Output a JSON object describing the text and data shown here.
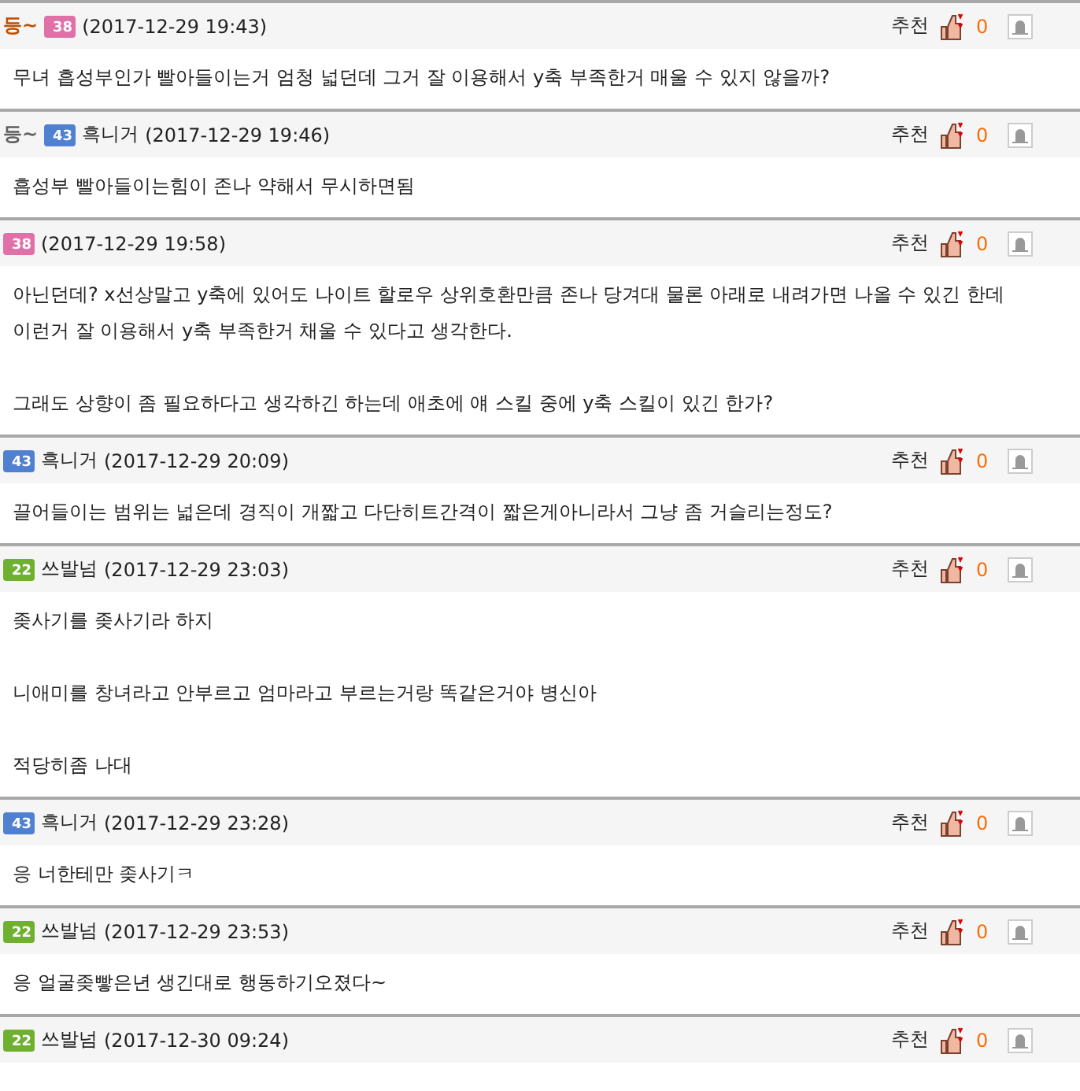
{
  "comments": [
    {
      "rank": {
        "text": "등~",
        "color": "#c05000"
      },
      "level": "38",
      "color": "#e070a8",
      "time": "(2017-12-29 19:43)",
      "recommend_label": "추천",
      "recommend_count": "0",
      "body": "무녀 흡성부인가 빨아들이는거 엄청 넓던데 그거 잘 이용해서 y축 부족한거 매울 수 있지 않을까?"
    },
    {
      "rank": {
        "text": "등~",
        "color": "#606060"
      },
      "level": "43",
      "color": "#5080d0",
      "author": "흑니거",
      "time": "(2017-12-29 19:46)",
      "recommend_label": "추천",
      "recommend_count": "0",
      "body": "흡성부 빨아들이는힘이 존나 약해서 무시하면됨"
    },
    {
      "level": "38",
      "color": "#e070a8",
      "time": "(2017-12-29 19:58)",
      "recommend_label": "추천",
      "recommend_count": "0",
      "body": "아닌던데? x선상말고 y축에 있어도 나이트 할로우 상위호환만큼 존나 당겨대 물론 아래로 내려가면 나올 수 있긴 한데\n이런거 잘 이용해서 y축 부족한거 채울 수 있다고 생각한다.\n\n그래도 상향이 좀 필요하다고 생각하긴 하는데 애초에 얘 스킬 중에 y축 스킬이 있긴 한가?"
    },
    {
      "level": "43",
      "color": "#5080d0",
      "author": "흑니거",
      "time": "(2017-12-29 20:09)",
      "recommend_label": "추천",
      "recommend_count": "0",
      "body": "끌어들이는 범위는 넓은데 경직이 개짧고 다단히트간격이 짧은게아니라서 그냥 좀 거슬리는정도?"
    },
    {
      "level": "22",
      "color": "#70b030",
      "author": "쓰발넘",
      "time": "(2017-12-29 23:03)",
      "recommend_label": "추천",
      "recommend_count": "0",
      "body": "좆사기를 좆사기라 하지\n\n니애미를 창녀라고 안부르고 엄마라고 부르는거랑 똑같은거야 병신아\n\n적당히좀 나대"
    },
    {
      "level": "43",
      "color": "#5080d0",
      "author": "흑니거",
      "time": "(2017-12-29 23:28)",
      "recommend_label": "추천",
      "recommend_count": "0",
      "body": "응 너한테만 좆사기ㅋ"
    },
    {
      "level": "22",
      "color": "#70b030",
      "author": "쓰발넘",
      "time": "(2017-12-29 23:53)",
      "recommend_label": "추천",
      "recommend_count": "0",
      "body": "응 얼굴좆빻은년 생긴대로 행동하기오졌다~"
    },
    {
      "level": "22",
      "color": "#70b030",
      "author": "쓰발넘",
      "time": "(2017-12-30 09:24)",
      "recommend_label": "추천",
      "recommend_count": "0"
    }
  ]
}
